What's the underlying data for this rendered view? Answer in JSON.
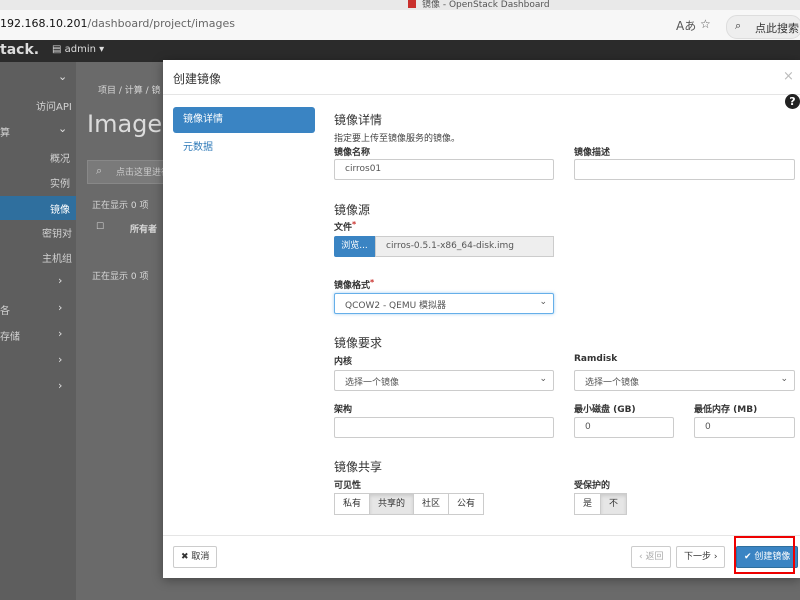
{
  "browser": {
    "window_title": "镜像 - OpenStack Dashboard",
    "url_host": "192.168.10.201",
    "url_path": "/dashboard/project/images",
    "search_label": "点此搜索"
  },
  "topnav": {
    "brand": "tack.",
    "project": "admin ▾"
  },
  "sidebar": {
    "items": [
      {
        "label": "访问API"
      },
      {
        "label": "算"
      },
      {
        "label": "概况"
      },
      {
        "label": "实例"
      },
      {
        "label": "镜像"
      },
      {
        "label": "密钥对"
      },
      {
        "label": "主机组"
      },
      {
        "label": "各"
      },
      {
        "label": "存储"
      }
    ]
  },
  "background": {
    "breadcrumb": "项目 / 计算 / 镜",
    "page_title": "Images",
    "search_placeholder": "点击这里进行",
    "showing_top": "正在显示 0 项",
    "owner_header": "所有者",
    "showing_bottom": "正在显示 0 项"
  },
  "modal": {
    "title": "创建镜像",
    "close": "×",
    "help_icon": "?",
    "nav": [
      {
        "label": "镜像详情",
        "active": true
      },
      {
        "label": "元数据",
        "active": false
      }
    ],
    "details": {
      "heading": "镜像详情",
      "help": "指定要上传至镜像服务的镜像。",
      "name_label": "镜像名称",
      "name_value": "cirros01",
      "desc_label": "镜像描述",
      "desc_value": ""
    },
    "source": {
      "heading": "镜像源",
      "file_label": "文件",
      "browse_label": "浏览...",
      "file_name": "cirros-0.5.1-x86_64-disk.img"
    },
    "format": {
      "label": "镜像格式",
      "value": "QCOW2 - QEMU 模拟器"
    },
    "requirements": {
      "heading": "镜像要求",
      "kernel_label": "内核",
      "kernel_value": "选择一个镜像",
      "ramdisk_label": "Ramdisk",
      "ramdisk_value": "选择一个镜像",
      "arch_label": "架构",
      "arch_value": "",
      "min_disk_label": "最小磁盘 (GB)",
      "min_disk_value": "0",
      "min_ram_label": "最低内存 (MB)",
      "min_ram_value": "0"
    },
    "sharing": {
      "heading": "镜像共享",
      "visibility_label": "可见性",
      "visibility_options": [
        {
          "label": "私有",
          "active": false
        },
        {
          "label": "共享的",
          "active": true
        },
        {
          "label": "社区",
          "active": false
        },
        {
          "label": "公有",
          "active": false
        }
      ],
      "protected_label": "受保护的",
      "protected_options": [
        {
          "label": "是",
          "active": false
        },
        {
          "label": "不",
          "active": true
        }
      ]
    },
    "footer": {
      "cancel": "✖ 取消",
      "back": "‹ 返回",
      "next": "下一步 ›",
      "create": "✔ 创建镜像"
    }
  },
  "colors": {
    "primary": "#3a84c3",
    "highlight": "#e00000"
  }
}
